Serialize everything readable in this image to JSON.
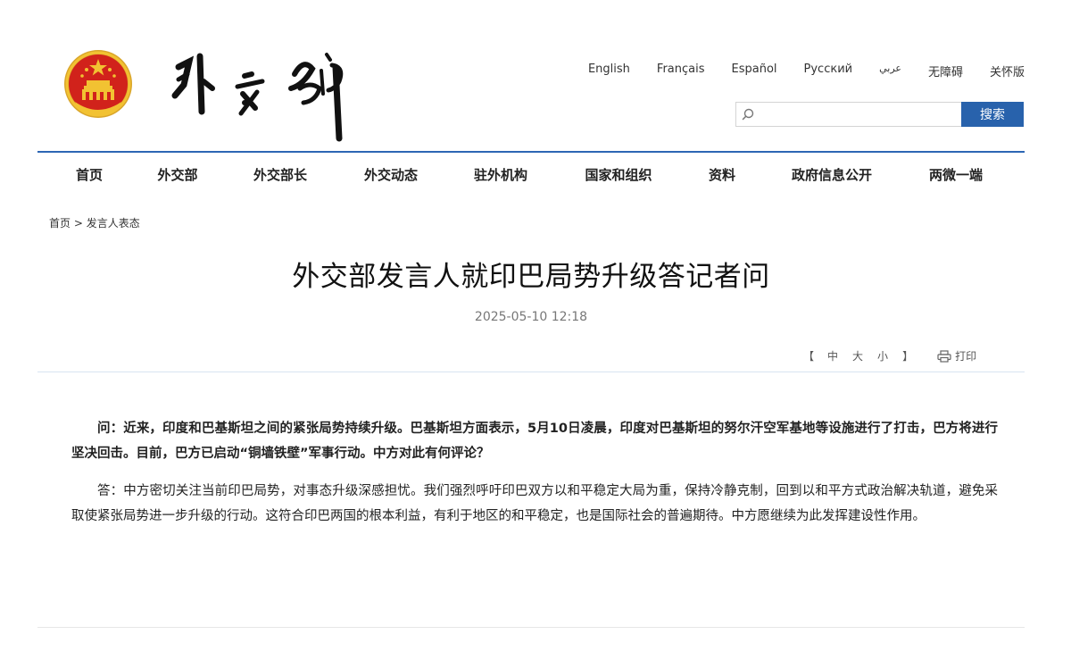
{
  "header": {
    "calligraphy_title": "外交部",
    "languages": [
      "English",
      "Français",
      "Español",
      "Русский",
      "عربي",
      "无障碍",
      "关怀版"
    ],
    "search": {
      "placeholder": "",
      "button_label": "搜索"
    }
  },
  "colors": {
    "accent_blue": "#2862ac",
    "emblem_red": "#d1221b",
    "emblem_gold": "#f2c232"
  },
  "nav": {
    "items": [
      "首页",
      "外交部",
      "外交部长",
      "外交动态",
      "驻外机构",
      "国家和组织",
      "资料",
      "政府信息公开",
      "两微一端"
    ]
  },
  "breadcrumb": {
    "home": "首页",
    "separator": ">",
    "current": "发言人表态"
  },
  "article": {
    "title": "外交部发言人就印巴局势升级答记者问",
    "date": "2025-05-10 12:18",
    "font_size_open": "【",
    "font_size_options": [
      "中",
      "大",
      "小"
    ],
    "font_size_close": "】",
    "print_label": "打印",
    "question": "问：近来，印度和巴基斯坦之间的紧张局势持续升级。巴基斯坦方面表示，5月10日凌晨，印度对巴基斯坦的努尔汗空军基地等设施进行了打击，巴方将进行坚决回击。目前，巴方已启动“铜墙铁壁”军事行动。中方对此有何评论？",
    "answer": "答：中方密切关注当前印巴局势，对事态升级深感担忧。我们强烈呼吁印巴双方以和平稳定大局为重，保持冷静克制，回到以和平方式政治解决轨道，避免采取使紧张局势进一步升级的行动。这符合印巴两国的根本利益，有利于地区的和平稳定，也是国际社会的普遍期待。中方愿继续为此发挥建设性作用。"
  },
  "icons": [
    "national-emblem-icon",
    "search-icon",
    "printer-icon"
  ]
}
